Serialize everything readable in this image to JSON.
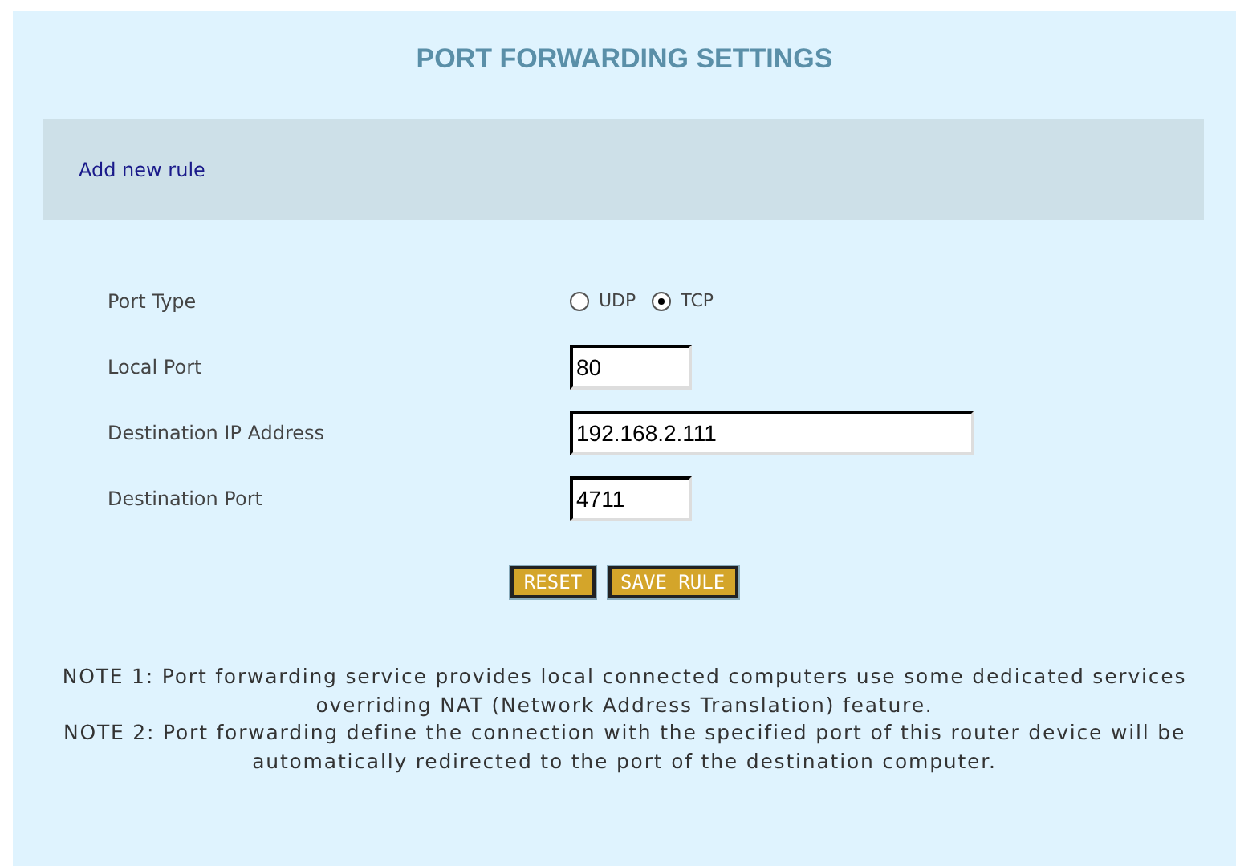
{
  "title": "PORT FORWARDING SETTINGS",
  "section": {
    "label": "Add new rule"
  },
  "form": {
    "rows": [
      {
        "kind": "radio",
        "label": "Port Type",
        "options": [
          {
            "label": "UDP",
            "selected": false
          },
          {
            "label": "TCP",
            "selected": true
          }
        ]
      },
      {
        "kind": "input",
        "label": "Local Port",
        "value": "80",
        "wide": false
      },
      {
        "kind": "input",
        "label": "Destination IP Address",
        "value": "192.168.2.111",
        "wide": true
      },
      {
        "kind": "input",
        "label": "Destination Port",
        "value": "4711",
        "wide": false
      }
    ]
  },
  "buttons": [
    "RESET",
    "SAVE RULE"
  ],
  "notes": [
    "NOTE 1: Port forwarding service provides local connected computers use some dedicated services overriding NAT (Network Address Translation) feature.",
    "NOTE 2: Port forwarding define the connection with the specified port of this router device will be automatically redirected to the port of the destination computer."
  ]
}
